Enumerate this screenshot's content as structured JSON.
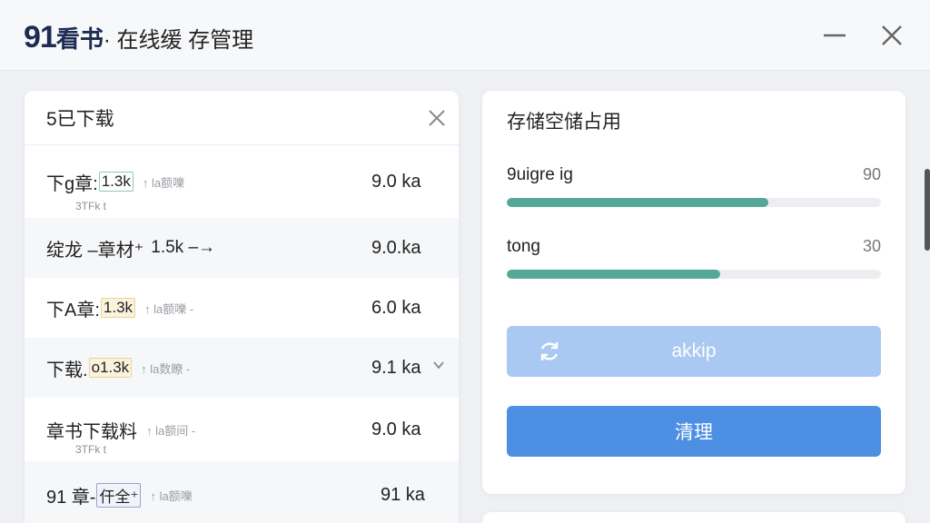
{
  "window": {
    "logo_num": "91",
    "logo_text": "看书",
    "subtitle": "· 在线缓 存管理"
  },
  "downloads": {
    "title": "5已下载",
    "items": [
      {
        "name": "下g章:",
        "tag": "1.3k",
        "meta": "↑ la额嚛",
        "sub": "3TFk t",
        "size": "9.0 ka"
      },
      {
        "name": "绽龙 –章材⁺",
        "tag": "",
        "meta": "1.5k –→",
        "sub": "",
        "size": "9.0.ka"
      },
      {
        "name": "下A章:",
        "tag": "1.3k",
        "meta": "↑ la额嚛 -",
        "sub": "",
        "size": "6.0 ka"
      },
      {
        "name": "下载.",
        "tag": "o1.3k",
        "meta": "↑ la数瞭 -",
        "sub": "",
        "size": "9.1 ka"
      },
      {
        "name": "章书下载料",
        "tag": "",
        "meta": "↑ la额间 -",
        "sub": "3TFk t",
        "size": "9.0 ka"
      },
      {
        "name": "91 章-",
        "tag": "仠全⁺",
        "meta": "↑ la额嚛",
        "sub": "",
        "size": "91 ka"
      }
    ]
  },
  "storage": {
    "title": "存储空储占用",
    "items": [
      {
        "label": "9uigre ig",
        "value": "90",
        "fill": 0.7
      },
      {
        "label": "tong",
        "value": "30",
        "fill": 0.57
      }
    ],
    "backup_label": "akkip",
    "clean_label": "清理"
  },
  "colors": {
    "accent": "#4c8fe3",
    "bar": "#55a898",
    "backup": "#a9c9f2"
  }
}
